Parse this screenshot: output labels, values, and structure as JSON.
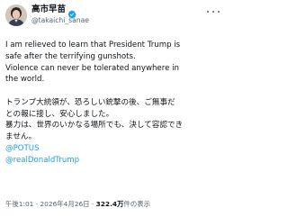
{
  "author": {
    "display_name": "高市早苗",
    "handle": "@takaichi_sanae",
    "verified_color": "#1d9bf0",
    "more_icon": "ellipsis-icon"
  },
  "post": {
    "en_lines": [
      "I am relieved to learn that President Trump is",
      "safe after the terrifying gunshots.",
      "Violence can never be tolerated anywhere in",
      "the world."
    ],
    "ja_lines": [
      "トランプ大統領が、恐ろしい銃撃の後、ご無事だ",
      "との報に接し、安心しました。",
      "暴力は、世界のいかなる場所でも、決して容認でき",
      "ません。"
    ],
    "mentions": [
      "@POTUS",
      "@realDonaldTrump"
    ]
  },
  "meta": {
    "time": "午後1:01",
    "separator": "·",
    "date": "2026年4月26日",
    "views_count": "322.4万",
    "views_label": "件の表示"
  },
  "colors": {
    "text": "#0f1419",
    "secondary": "#536471",
    "link": "#1d9bf0"
  }
}
